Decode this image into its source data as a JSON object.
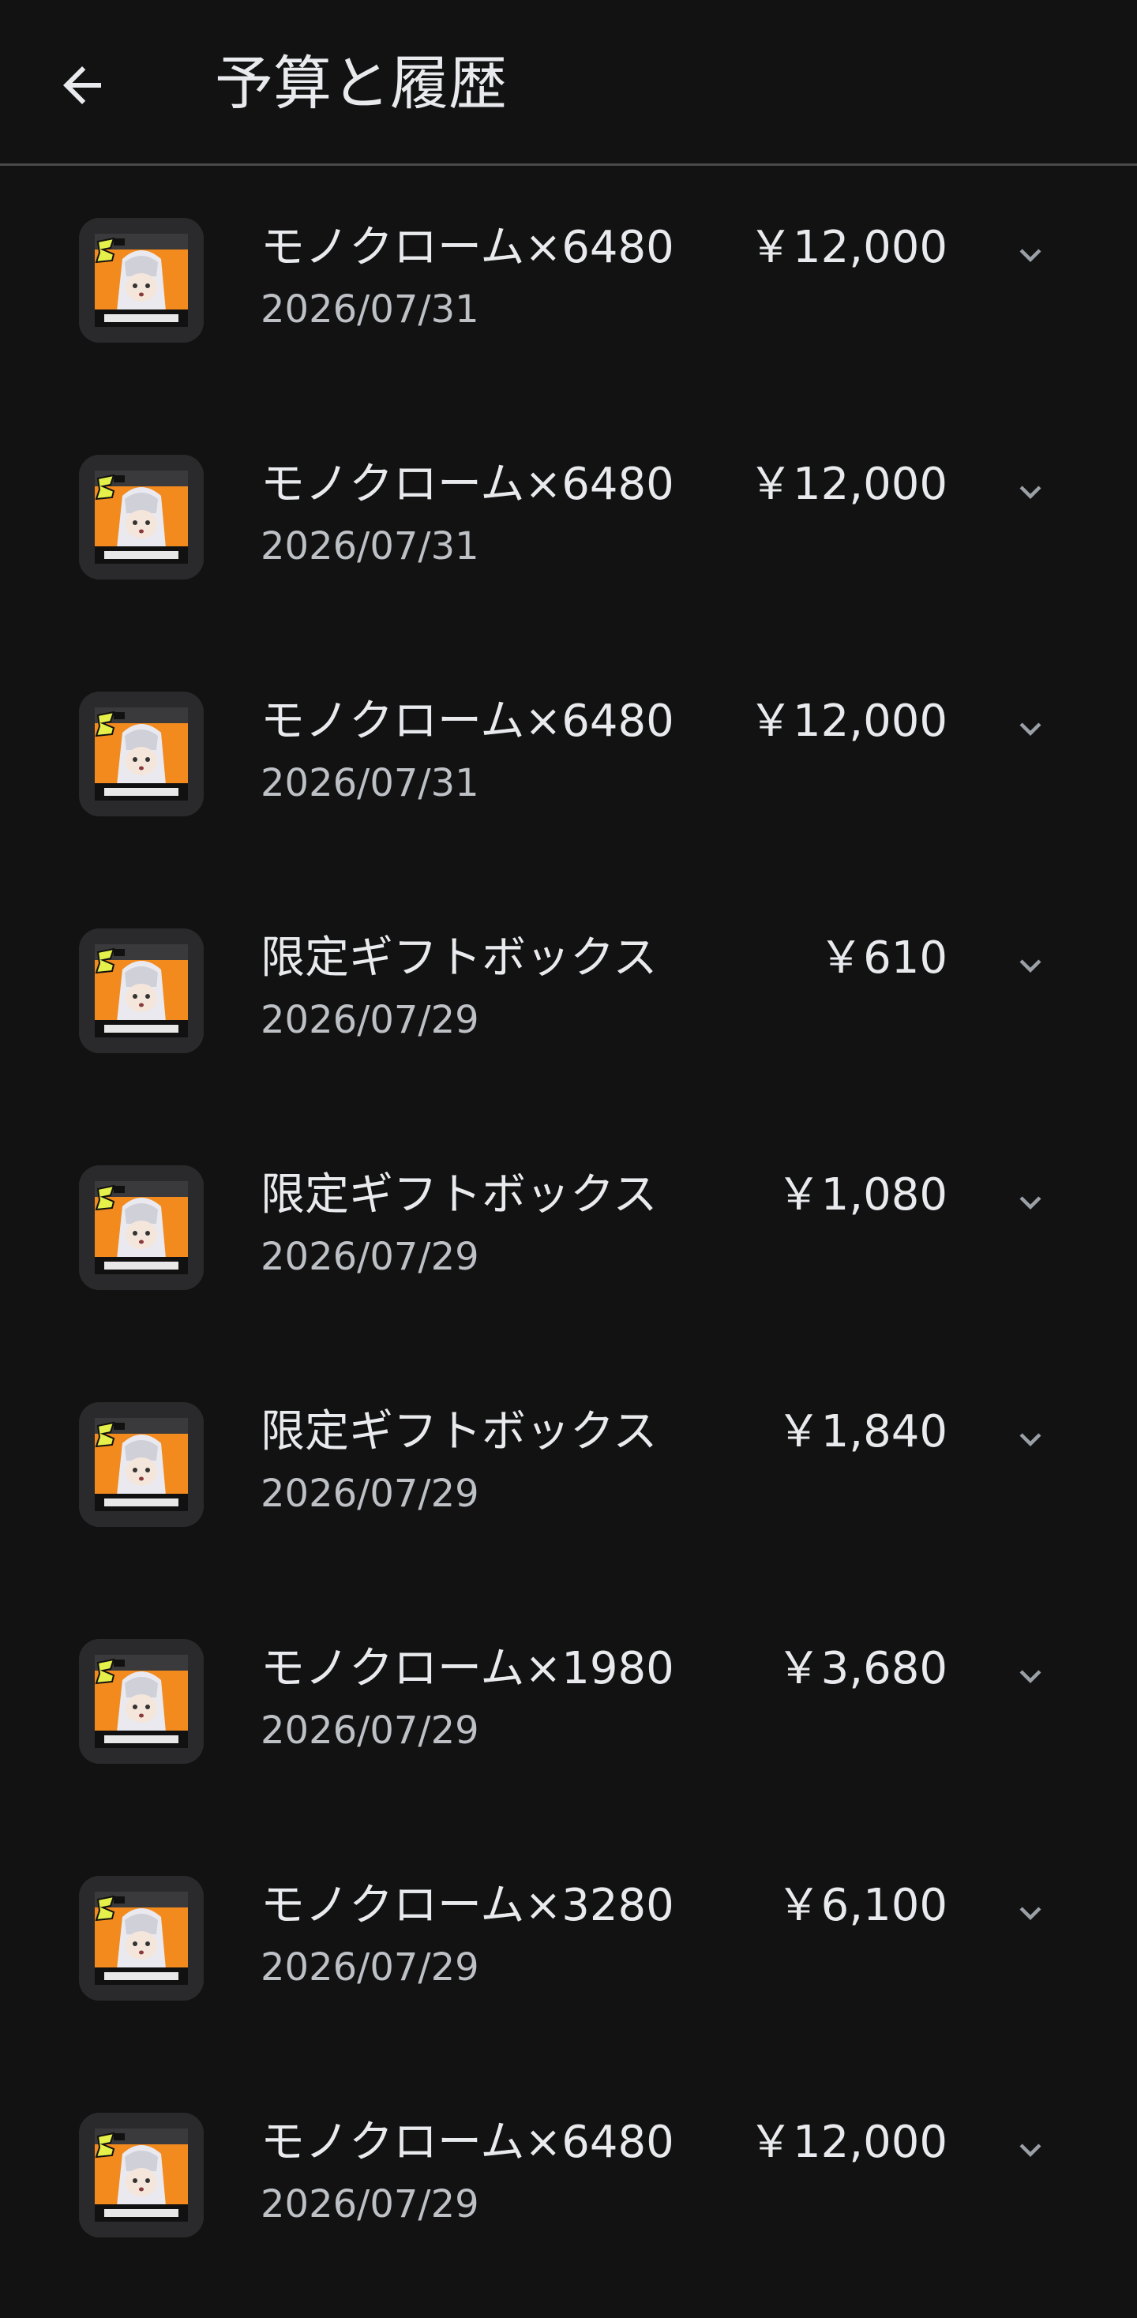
{
  "header": {
    "back_icon": "arrow-back-icon",
    "title": "予算と履歴"
  },
  "colors": {
    "background": "#121212",
    "text_primary": "#e8eaed",
    "text_secondary": "#bdc1c6",
    "chevron": "#9aa0a6",
    "divider": "#4a4a4a",
    "icon_orange": "#f28a1e",
    "icon_badge_yellow": "#e6f04a"
  },
  "transactions": [
    {
      "name": "モノクローム×6480",
      "date": "2026/07/31",
      "price": "￥12,000",
      "icon": "game-app-icon",
      "expand_icon": "chevron-down-icon"
    },
    {
      "name": "モノクローム×6480",
      "date": "2026/07/31",
      "price": "￥12,000",
      "icon": "game-app-icon",
      "expand_icon": "chevron-down-icon"
    },
    {
      "name": "モノクローム×6480",
      "date": "2026/07/31",
      "price": "￥12,000",
      "icon": "game-app-icon",
      "expand_icon": "chevron-down-icon"
    },
    {
      "name": "限定ギフトボックス",
      "date": "2026/07/29",
      "price": "￥610",
      "icon": "game-app-icon",
      "expand_icon": "chevron-down-icon"
    },
    {
      "name": "限定ギフトボックス",
      "date": "2026/07/29",
      "price": "￥1,080",
      "icon": "game-app-icon",
      "expand_icon": "chevron-down-icon"
    },
    {
      "name": "限定ギフトボックス",
      "date": "2026/07/29",
      "price": "￥1,840",
      "icon": "game-app-icon",
      "expand_icon": "chevron-down-icon"
    },
    {
      "name": "モノクローム×1980",
      "date": "2026/07/29",
      "price": "￥3,680",
      "icon": "game-app-icon",
      "expand_icon": "chevron-down-icon"
    },
    {
      "name": "モノクローム×3280",
      "date": "2026/07/29",
      "price": "￥6,100",
      "icon": "game-app-icon",
      "expand_icon": "chevron-down-icon"
    },
    {
      "name": "モノクローム×6480",
      "date": "2026/07/29",
      "price": "￥12,000",
      "icon": "game-app-icon",
      "expand_icon": "chevron-down-icon"
    }
  ]
}
